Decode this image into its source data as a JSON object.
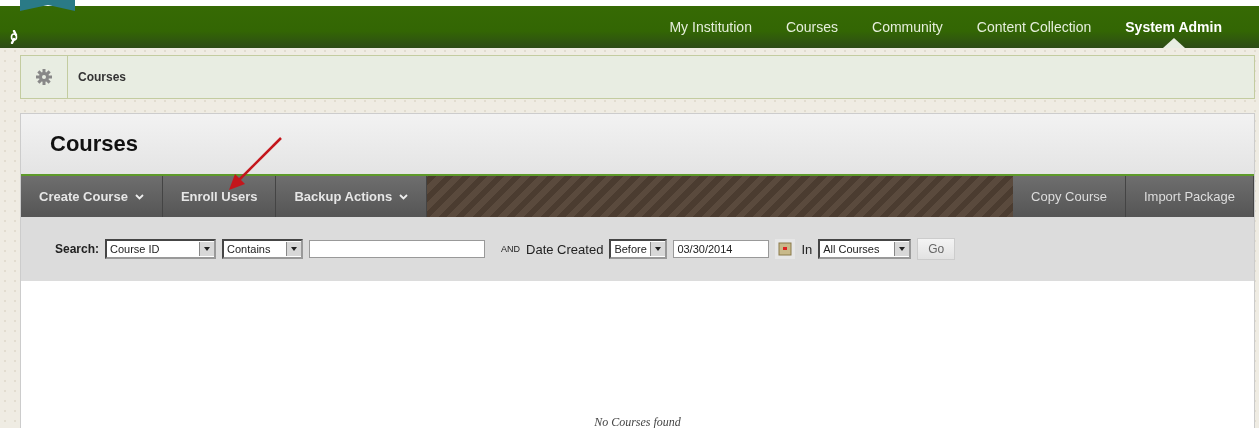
{
  "top_nav": [
    {
      "label": "My Institution",
      "selected": false
    },
    {
      "label": "Courses",
      "selected": false
    },
    {
      "label": "Community",
      "selected": false
    },
    {
      "label": "Content Collection",
      "selected": false
    },
    {
      "label": "System Admin",
      "selected": true
    }
  ],
  "breadcrumb": {
    "label": "Courses"
  },
  "page_title": "Courses",
  "action_bar": {
    "left": [
      {
        "label": "Create Course",
        "has_menu": true
      },
      {
        "label": "Enroll Users",
        "has_menu": false
      },
      {
        "label": "Backup Actions",
        "has_menu": true
      }
    ],
    "right": [
      {
        "label": "Copy Course",
        "has_menu": false
      },
      {
        "label": "Import Package",
        "has_menu": false
      }
    ]
  },
  "search": {
    "label": "Search:",
    "field": {
      "value": "Course ID"
    },
    "operator": {
      "value": "Contains"
    },
    "and_label": "AND",
    "date_label": "Date Created",
    "date_operator": {
      "value": "Before"
    },
    "date": {
      "value": "03/30/2014"
    },
    "in_label": "In",
    "scope": {
      "value": "All Courses"
    },
    "go": "Go"
  },
  "empty_message": "No Courses found"
}
